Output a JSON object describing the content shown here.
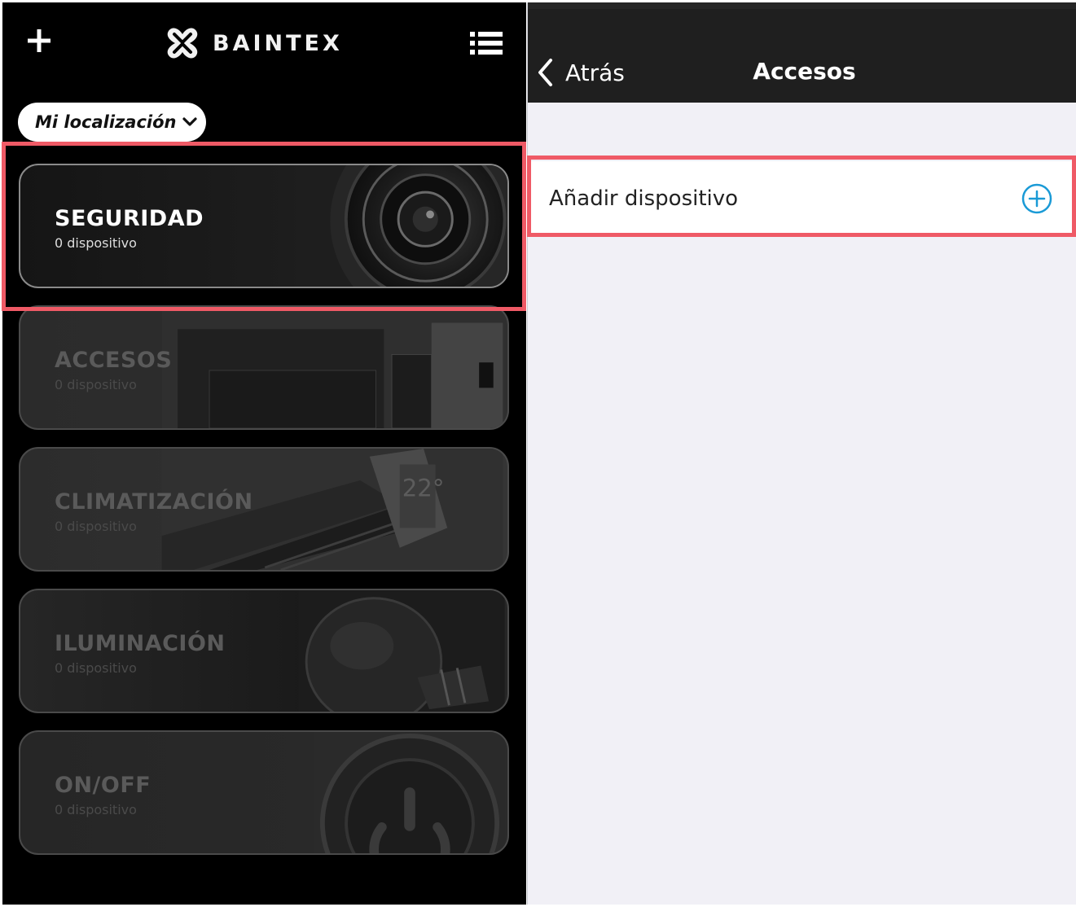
{
  "left_screen": {
    "brand": {
      "name": "BAINTEX",
      "logo_icon": "baintex-x-logo-icon"
    },
    "header": {
      "add_icon": "plus-icon",
      "menu_icon": "list-menu-icon"
    },
    "location_selector": {
      "label": "Mi localización",
      "icon": "chevron-down-icon"
    },
    "categories": [
      {
        "title": "SEGURIDAD",
        "subtitle": "0 dispositivo",
        "art": "camera-lens"
      },
      {
        "title": "ACCESOS",
        "subtitle": "0 dispositivo",
        "art": "doorway"
      },
      {
        "title": "CLIMATIZACIÓN",
        "subtitle": "0 dispositivo",
        "art": "air-conditioner",
        "display": "22°"
      },
      {
        "title": "ILUMINACIÓN",
        "subtitle": "0 dispositivo",
        "art": "light-bulb"
      },
      {
        "title": "ON/OFF",
        "subtitle": "0 dispositivo",
        "art": "power-button"
      }
    ],
    "highlight_color": "#ef5a66"
  },
  "right_screen": {
    "nav": {
      "back_label": "Atrás",
      "title": "Accesos"
    },
    "rows": [
      {
        "label": "Añadir dispositivo",
        "icon": "add-circle-icon"
      }
    ],
    "accent_color": "#1a9ad6",
    "highlight_color": "#ef5a66"
  }
}
